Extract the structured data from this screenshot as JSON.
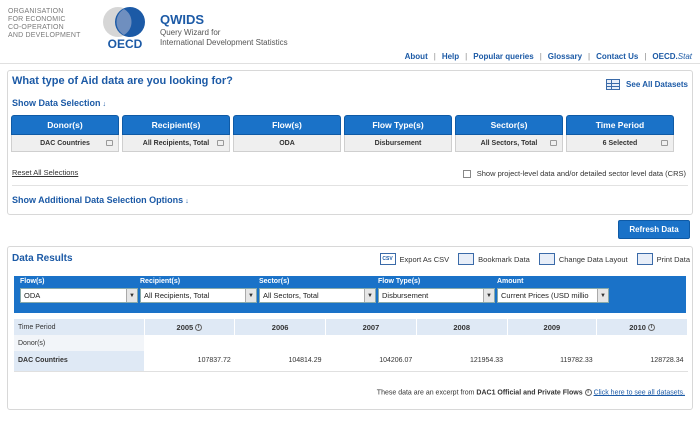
{
  "header": {
    "org_lines": [
      "ORGANISATION",
      "FOR ECONOMIC",
      "CO-OPERATION",
      "AND DEVELOPMENT"
    ],
    "logo_text": "OECD",
    "app_title": "QWIDS",
    "app_subtitle_1": "Query Wizard for",
    "app_subtitle_2": "International Development Statistics"
  },
  "nav": {
    "about": "About",
    "help": "Help",
    "popular": "Popular queries",
    "glossary": "Glossary",
    "contact": "Contact Us",
    "stat_bold": "OECD.",
    "stat_italic": "Stat"
  },
  "selection": {
    "question": "What type of Aid data are you looking for?",
    "see_all": "See All Datasets",
    "show_selection": "Show Data Selection",
    "tabs": [
      {
        "label": "Donor(s)",
        "value": "DAC Countries"
      },
      {
        "label": "Recipient(s)",
        "value": "All Recipients, Total"
      },
      {
        "label": "Flow(s)",
        "value": "ODA"
      },
      {
        "label": "Flow Type(s)",
        "value": "Disbursement"
      },
      {
        "label": "Sector(s)",
        "value": "All Sectors, Total"
      },
      {
        "label": "Time Period",
        "value": "6 Selected"
      }
    ],
    "reset": "Reset All Selections",
    "crs_label": "Show project-level data and/or detailed sector level data (CRS)",
    "show_additional": "Show Additional Data Selection Options"
  },
  "refresh_label": "Refresh Data",
  "results": {
    "title": "Data Results",
    "actions": {
      "csv_icon": "CSV",
      "export": "Export As CSV",
      "bookmark": "Bookmark Data",
      "layout": "Change Data Layout",
      "print": "Print Data"
    },
    "filters": [
      {
        "label": "Flow(s)",
        "value": "ODA"
      },
      {
        "label": "Recipient(s)",
        "value": "All Recipients, Total"
      },
      {
        "label": "Sector(s)",
        "value": "All Sectors, Total"
      },
      {
        "label": "Flow Type(s)",
        "value": "Disbursement"
      },
      {
        "label": "Amount",
        "value": "Current Prices (USD millio"
      }
    ],
    "time_period_label": "Time Period",
    "donor_label": "Donor(s)",
    "years": [
      "2005",
      "2006",
      "2007",
      "2008",
      "2009",
      "2010"
    ],
    "row": {
      "name": "DAC Countries",
      "values": [
        "107837.72",
        "104814.29",
        "104206.07",
        "121954.33",
        "119782.33",
        "128728.34"
      ]
    },
    "footer": {
      "prefix": "These data are an excerpt from ",
      "source": "DAC1 Official and Private Flows",
      "link": "Click here to see all datasets."
    }
  },
  "colors": {
    "brand_blue": "#1c5aa6",
    "bar_blue": "#1a72c8",
    "cell_blue": "#dfe9f5"
  }
}
